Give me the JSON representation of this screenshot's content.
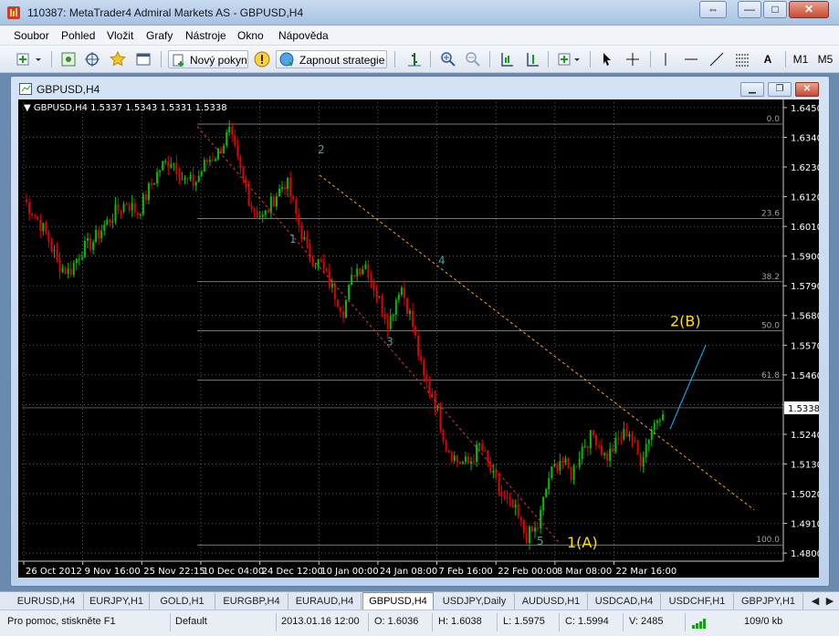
{
  "window": {
    "title": "110387: MetaTrader4 Admiral Markets AS - GBPUSD,H4",
    "controls": {
      "restore": "⇔",
      "minimize": "—",
      "maximize": "□",
      "close": "✕"
    }
  },
  "menu": {
    "items": [
      "Soubor",
      "Pohled",
      "Vložit",
      "Grafy",
      "Nástroje",
      "Okno",
      "Nápověda"
    ]
  },
  "toolbar": {
    "new_order_label": "Nový pokyn",
    "autotrading_label": "Zapnout strategie",
    "text_tool": "A",
    "period_m1": "M1",
    "period_m5": "M5"
  },
  "chart_window": {
    "title": "GBPUSD,H4"
  },
  "chart_data": {
    "type": "candlestick",
    "symbol_header": "GBPUSD,H4  1.5337 1.5343 1.5331 1.5338",
    "current_price_label": "1.5338",
    "y_ticks": [
      "1.6450",
      "1.6340",
      "1.6230",
      "1.6120",
      "1.6010",
      "1.5900",
      "1.5790",
      "1.5680",
      "1.5570",
      "1.5460",
      "1.5350",
      "1.5240",
      "1.5130",
      "1.5020",
      "1.4910",
      "1.4800"
    ],
    "ylim": [
      1.477,
      1.647
    ],
    "x_ticks": [
      "26 Oct 2012",
      "9 Nov 16:00",
      "25 Nov 22:15",
      "10 Dec 04:00",
      "24 Dec 12:00",
      "10 Jan 00:00",
      "24 Jan 08:00",
      "7 Feb 16:00",
      "22 Feb 00:00",
      "8 Mar 08:00",
      "22 Mar 16:00"
    ],
    "close_path": [
      1.611,
      1.605,
      1.598,
      1.587,
      1.584,
      1.592,
      1.595,
      1.601,
      1.606,
      1.61,
      1.606,
      1.615,
      1.623,
      1.626,
      1.618,
      1.617,
      1.625,
      1.628,
      1.636,
      1.621,
      1.608,
      1.604,
      1.612,
      1.618,
      1.603,
      1.59,
      1.587,
      1.578,
      1.57,
      1.585,
      1.587,
      1.575,
      1.565,
      1.58,
      1.566,
      1.545,
      1.537,
      1.52,
      1.514,
      1.513,
      1.52,
      1.509,
      1.5,
      1.496,
      1.486,
      1.489,
      1.508,
      1.515,
      1.509,
      1.52,
      1.524,
      1.515,
      1.521,
      1.526,
      1.514,
      1.526,
      1.534
    ],
    "fibonacci_levels": [
      {
        "label": "0.0",
        "price": 1.6389
      },
      {
        "label": "23.6",
        "price": 1.6039
      },
      {
        "label": "38.2",
        "price": 1.5805
      },
      {
        "label": "50.0",
        "price": 1.5623
      },
      {
        "label": "61.8",
        "price": 1.544
      },
      {
        "label": "100.0",
        "price": 1.483
      }
    ],
    "wave_labels": [
      "1",
      "2",
      "3",
      "4",
      "5"
    ],
    "big_labels": [
      "1(A)",
      "2(B)"
    ],
    "colors": {
      "bull": "#00c000",
      "bear": "#e00000",
      "grid": "#7a7a7a",
      "fib": "#a0a0a0",
      "channel_lower": "#e03030",
      "channel_upper": "#ffa500",
      "projection": "#00bfff",
      "wave": "#3fa6a6",
      "big_label": "#ffe000"
    }
  },
  "tabs": [
    {
      "label": "EURUSD,H4",
      "active": false
    },
    {
      "label": "EURJPY,H1",
      "active": false
    },
    {
      "label": "GOLD,H1",
      "active": false
    },
    {
      "label": "EURGBP,H4",
      "active": false
    },
    {
      "label": "EURAUD,H4",
      "active": false
    },
    {
      "label": "GBPUSD,H4",
      "active": true
    },
    {
      "label": "USDJPY,Daily",
      "active": false
    },
    {
      "label": "AUDUSD,H1",
      "active": false
    },
    {
      "label": "USDCAD,H4",
      "active": false
    },
    {
      "label": "USDCHF,H1",
      "active": false
    },
    {
      "label": "GBPJPY,H1",
      "active": false
    }
  ],
  "status": {
    "help": "Pro pomoc, stiskněte F1",
    "profile": "Default",
    "datetime": "2013.01.16 12:00",
    "open": "O: 1.6036",
    "high": "H: 1.6038",
    "low": "L: 1.5975",
    "close": "C: 1.5994",
    "volume": "V: 2485",
    "traffic": "109/0 kb"
  }
}
